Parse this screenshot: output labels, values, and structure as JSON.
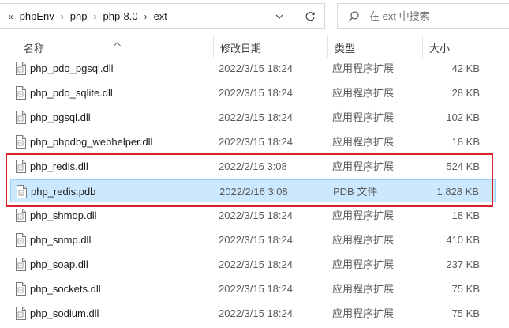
{
  "address_bar": {
    "breadcrumbs": [
      "phpEnv",
      "php",
      "php-8.0",
      "ext"
    ],
    "overflow_glyph": "«",
    "separator_glyph": "›"
  },
  "search": {
    "placeholder": "在 ext 中搜索"
  },
  "columns": {
    "name": "名称",
    "date": "修改日期",
    "type": "类型",
    "size": "大小"
  },
  "files": [
    {
      "name": "php_pdo_pgsql.dll",
      "date": "2022/3/15 18:24",
      "type": "应用程序扩展",
      "size": "42 KB"
    },
    {
      "name": "php_pdo_sqlite.dll",
      "date": "2022/3/15 18:24",
      "type": "应用程序扩展",
      "size": "28 KB"
    },
    {
      "name": "php_pgsql.dll",
      "date": "2022/3/15 18:24",
      "type": "应用程序扩展",
      "size": "102 KB"
    },
    {
      "name": "php_phpdbg_webhelper.dll",
      "date": "2022/3/15 18:24",
      "type": "应用程序扩展",
      "size": "18 KB"
    },
    {
      "name": "php_redis.dll",
      "date": "2022/2/16 3:08",
      "type": "应用程序扩展",
      "size": "524 KB"
    },
    {
      "name": "php_redis.pdb",
      "date": "2022/2/16 3:08",
      "type": "PDB 文件",
      "size": "1,828 KB"
    },
    {
      "name": "php_shmop.dll",
      "date": "2022/3/15 18:24",
      "type": "应用程序扩展",
      "size": "18 KB"
    },
    {
      "name": "php_snmp.dll",
      "date": "2022/3/15 18:24",
      "type": "应用程序扩展",
      "size": "410 KB"
    },
    {
      "name": "php_soap.dll",
      "date": "2022/3/15 18:24",
      "type": "应用程序扩展",
      "size": "237 KB"
    },
    {
      "name": "php_sockets.dll",
      "date": "2022/3/15 18:24",
      "type": "应用程序扩展",
      "size": "75 KB"
    },
    {
      "name": "php_sodium.dll",
      "date": "2022/3/15 18:24",
      "type": "应用程序扩展",
      "size": "75 KB"
    }
  ],
  "selected_file": "php_redis.pdb",
  "highlighted_files": [
    "php_redis.dll",
    "php_redis.pdb"
  ],
  "colors": {
    "selection_fill": "#cce8ff",
    "selection_border": "#99d1ff",
    "highlight_border": "#d9262c"
  },
  "icons": {
    "folder": "folder-icon",
    "chevron": "chevron-down-icon",
    "refresh": "refresh-icon",
    "search": "search-icon",
    "sort": "sort-ascending-icon",
    "file": "file-icon"
  }
}
